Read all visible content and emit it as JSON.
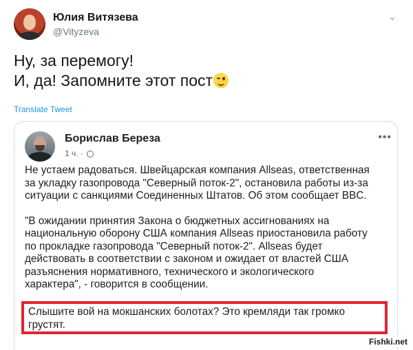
{
  "tweet": {
    "author_name": "Юлия Витязева",
    "author_handle": "@Vityzeva",
    "text_line1": "Ну, за перемогу!",
    "text_line2": "И, да! Запомните этот пост",
    "emoji": "winking-face",
    "translate_label": "Translate Tweet"
  },
  "embedded_post": {
    "author_name": "Борислав Береза",
    "time": "1 ч.",
    "visibility_icon": "globe-icon",
    "more_label": "•••",
    "paragraph1": [
      "Не устаем радоваться. Швейцарская компания Allseas, ответственная",
      "за укладку газопровода \"Северный поток-2\", остановила работы из-за",
      "ситуации с санкциями Соединенных Штатов. Об этом сообщает BBC."
    ],
    "paragraph2": [
      "\"В ожидании принятия Закона о бюджетных ассигнованиях на",
      "национальную оборону США компания Allseas приостановила работу",
      "по прокладке газопровода \"Северный поток-2\". Allseas будет",
      "действовать в соответствии с законом и ожидает от властей США",
      "разъяснения нормативного, технического и экологического",
      "характера\", - говорится в сообщении."
    ],
    "highlighted": [
      "Слышите вой на мокшанских болотах? Это кремляди так громко",
      "грустят."
    ],
    "highlight_color": "#e4222f"
  },
  "watermark": "Fishki.net",
  "colors": {
    "link": "#1b95e0",
    "handle": "#657786",
    "card_border": "#d4dde3"
  }
}
